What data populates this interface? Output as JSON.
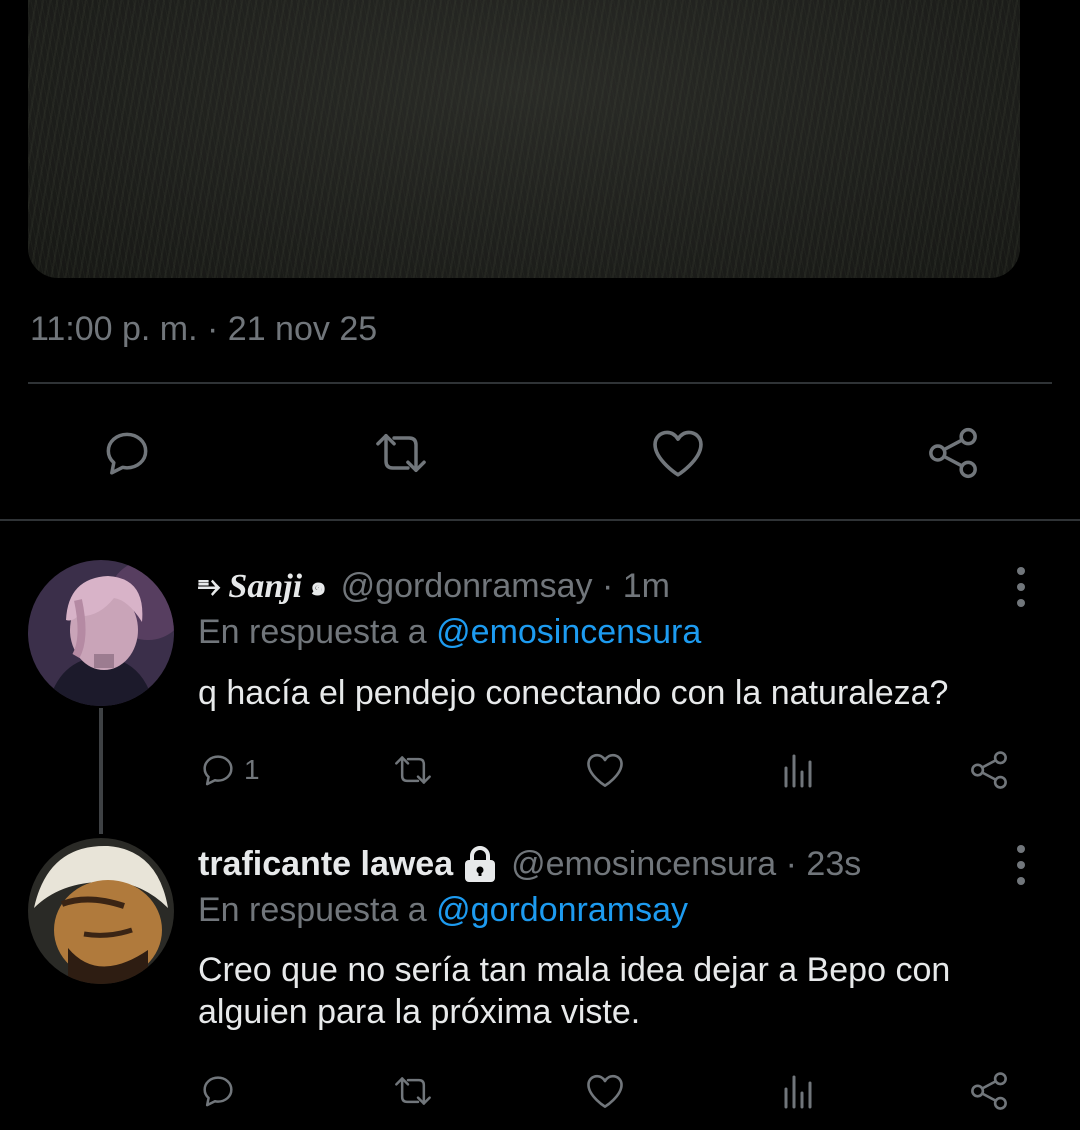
{
  "main_tweet": {
    "timestamp": "11:00 p. m. · 21 nov 25",
    "actions": [
      "reply-icon",
      "retweet-icon",
      "like-icon",
      "share-icon"
    ]
  },
  "replies": [
    {
      "name_prefix": "⥱",
      "display_name": "Sanji",
      "name_suffix": "๑",
      "handle": "@gordonramsay",
      "sep": " · ",
      "time": "1m",
      "reply_label": "En respuesta a ",
      "reply_to": "@emosincensura",
      "text": "q hacía el pendejo conectando con la naturaleza?",
      "reply_count": "1"
    },
    {
      "display_name": "traficante lawea",
      "protected_icon": "lock-icon",
      "handle": "@emosincensura",
      "sep": " · ",
      "time": "23s",
      "reply_label": "En respuesta a ",
      "reply_to": "@gordonramsay",
      "text_line1": "Creo que no sería tan mala idea dejar a Bepo con",
      "text_line2": "alguien para la próxima viste.",
      "reply_count": ""
    }
  ],
  "colors": {
    "background": "#000000",
    "text": "#e7e9ea",
    "muted": "#71767b",
    "link": "#1d9bf0",
    "divider": "#2f3336"
  }
}
